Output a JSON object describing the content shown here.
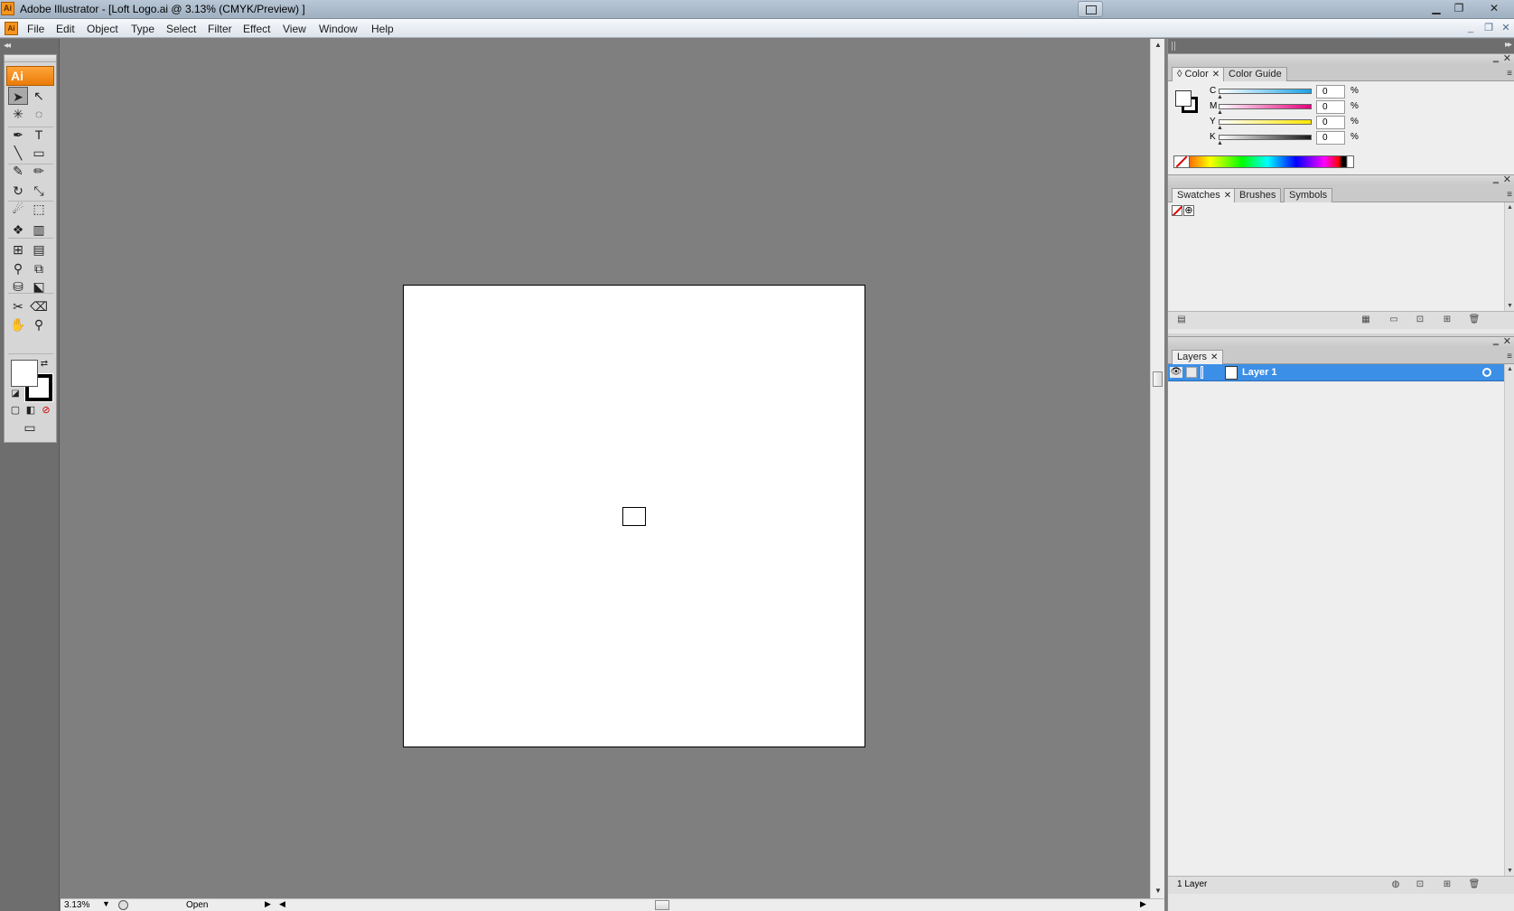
{
  "window": {
    "title": "Adobe Illustrator - [Loft Logo.ai @ 3.13% (CMYK/Preview) ]",
    "app_icon": "Ai",
    "controls": [
      "minimize-icon",
      "restore-icon",
      "close-icon"
    ]
  },
  "menubar": {
    "doc_icon": "Ai",
    "items": [
      "File",
      "Edit",
      "Object",
      "Type",
      "Select",
      "Filter",
      "Effect",
      "View",
      "Window",
      "Help"
    ],
    "mdi_controls": [
      "_",
      "❐",
      "✕"
    ]
  },
  "tools_panel": {
    "logo": "Ai",
    "tools": [
      {
        "name": "selection-tool",
        "glyph": "➤",
        "active": true
      },
      {
        "name": "direct-selection-tool",
        "glyph": "↖"
      },
      {
        "name": "magic-wand-tool",
        "glyph": "✳"
      },
      {
        "name": "lasso-tool",
        "glyph": "◌"
      },
      {
        "name": "pen-tool",
        "glyph": "✒"
      },
      {
        "name": "type-tool",
        "glyph": "T"
      },
      {
        "name": "line-tool",
        "glyph": "╲"
      },
      {
        "name": "rectangle-tool",
        "glyph": "▭"
      },
      {
        "name": "paintbrush-tool",
        "glyph": "✎"
      },
      {
        "name": "pencil-tool",
        "glyph": "✏"
      },
      {
        "name": "rotate-tool",
        "glyph": "↻"
      },
      {
        "name": "scale-tool",
        "glyph": "⤡"
      },
      {
        "name": "warp-tool",
        "glyph": "☄"
      },
      {
        "name": "free-transform-tool",
        "glyph": "⬚"
      },
      {
        "name": "symbol-sprayer-tool",
        "glyph": "❖"
      },
      {
        "name": "column-graph-tool",
        "glyph": "▥"
      },
      {
        "name": "mesh-tool",
        "glyph": "⊞"
      },
      {
        "name": "gradient-tool",
        "glyph": "▤"
      },
      {
        "name": "eyedropper-tool",
        "glyph": "⚲"
      },
      {
        "name": "blend-tool",
        "glyph": "⧉"
      },
      {
        "name": "live-paint-bucket-tool",
        "glyph": "⛁"
      },
      {
        "name": "live-paint-selection-tool",
        "glyph": "⬕"
      },
      {
        "name": "slice-tool",
        "glyph": "✂"
      },
      {
        "name": "eraser-tool",
        "glyph": "⌫"
      },
      {
        "name": "hand-tool",
        "glyph": "✋"
      },
      {
        "name": "zoom-tool",
        "glyph": "⚲"
      }
    ]
  },
  "statusbar": {
    "zoom": "3.13%",
    "status": "Open"
  },
  "color_panel": {
    "tabs": [
      "Color",
      "Color Guide"
    ],
    "channels": [
      {
        "label": "C",
        "value": "0",
        "color": "#1aa3e8"
      },
      {
        "label": "M",
        "value": "0",
        "color": "#e6007e"
      },
      {
        "label": "Y",
        "value": "0",
        "color": "#ffe600"
      },
      {
        "label": "K",
        "value": "0",
        "color": "#1a1a1a"
      }
    ],
    "unit": "%"
  },
  "swatches_panel": {
    "tabs": [
      "Swatches",
      "Brushes",
      "Symbols"
    ]
  },
  "layers_panel": {
    "tabs": [
      "Layers"
    ],
    "layers": [
      {
        "name": "Layer 1",
        "selected": true
      }
    ],
    "footer": "1 Layer",
    "selection_color": "#3c8fe6"
  },
  "colors": {
    "canvas_bg": "#7f7f7f",
    "artboard": "#ffffff",
    "accent": "#f7941d"
  }
}
